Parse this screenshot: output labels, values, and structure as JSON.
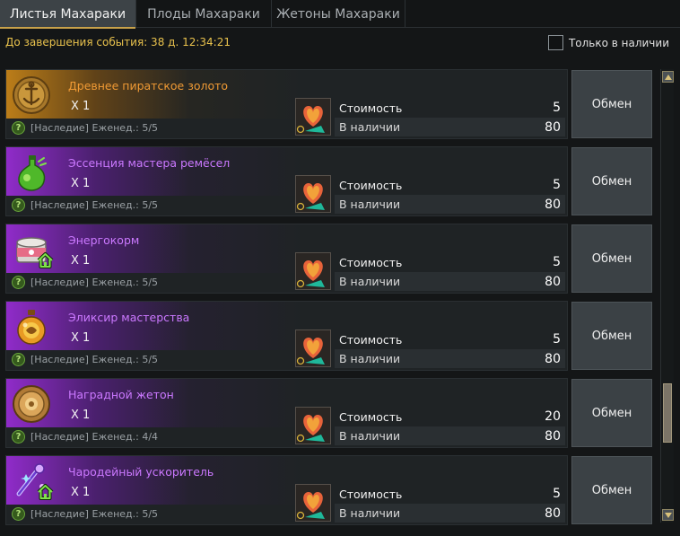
{
  "tabs": [
    {
      "label": "Листья Махараки",
      "active": true
    },
    {
      "label": "Плоды Махараки",
      "active": false
    },
    {
      "label": "Жетоны Махараки",
      "active": false
    }
  ],
  "timer": "До завершения события: 38 д. 12:34:21",
  "filter": {
    "label": "Только в наличии",
    "checked": false
  },
  "labels": {
    "cost": "Стоимость",
    "stock": "В наличии",
    "button": "Обмен"
  },
  "items": [
    {
      "name": "Древнее пиратское золото",
      "qty": "X 1",
      "note": "[Наследие] Еженед.: 5/5",
      "cost": "5",
      "stock": "80",
      "rarity": "gold",
      "icon": "pirate-gold-coin-icon",
      "home": false
    },
    {
      "name": "Эссенция мастера ремёсел",
      "qty": "X 1",
      "note": "[Наследие] Еженед.: 5/5",
      "cost": "5",
      "stock": "80",
      "rarity": "purple",
      "icon": "green-essence-flask-icon",
      "home": false
    },
    {
      "name": "Энергокорм",
      "qty": "X 1",
      "note": "[Наследие] Еженед.: 5/5",
      "cost": "5",
      "stock": "80",
      "rarity": "purple",
      "icon": "pet-food-can-icon",
      "home": true
    },
    {
      "name": "Эликсир мастерства",
      "qty": "X 1",
      "note": "[Наследие] Еженед.: 5/5",
      "cost": "5",
      "stock": "80",
      "rarity": "purple",
      "icon": "golden-elixir-flask-icon",
      "home": false
    },
    {
      "name": "Наградной жетон",
      "qty": "X 1",
      "note": "[Наследие] Еженед.: 4/4",
      "cost": "20",
      "stock": "80",
      "rarity": "purple",
      "icon": "reward-token-coin-icon",
      "home": false
    },
    {
      "name": "Чародейный ускоритель",
      "qty": "X 1",
      "note": "[Наследие] Еженед.: 5/5",
      "cost": "5",
      "stock": "80",
      "rarity": "purple",
      "icon": "sorcery-accelerator-icon",
      "home": true
    }
  ],
  "colors": {
    "gold_text": "#f09a34",
    "purple_text": "#cb78ff",
    "timer": "#e9c24d",
    "tab_active_underline": "#c9a24a"
  }
}
